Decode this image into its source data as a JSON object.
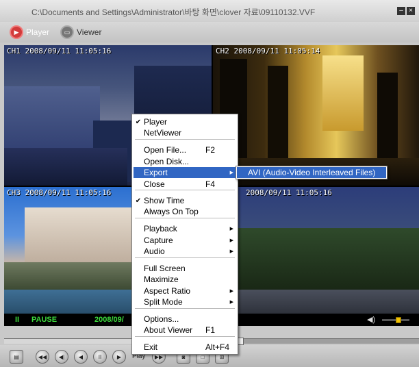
{
  "window": {
    "title": "C:\\Documents and Settings\\Administrator\\바탕 화면\\clover 자료\\09110132.VVF",
    "minimize": "–",
    "close": "×"
  },
  "modes": {
    "player_label": "Player",
    "viewer_label": "Viewer"
  },
  "cameras": [
    {
      "label": "CH1 2008/09/11 11:05:16"
    },
    {
      "label": "CH2 2008/09/11 11:05:14"
    },
    {
      "label": "CH3 2008/09/11 11:05:16"
    },
    {
      "label": "2008/09/11 11:05:16"
    }
  ],
  "status": {
    "pause_icon": "II",
    "state": "PAUSE",
    "time": "2008/09/",
    "volume_level": 0.6
  },
  "seek": {
    "position": 0.57
  },
  "controls": {
    "play_label": "Play"
  },
  "context_menu": {
    "items": [
      {
        "label": "Player",
        "checked": true
      },
      {
        "label": "NetViewer"
      },
      {
        "label": "Open File...",
        "shortcut": "F2"
      },
      {
        "label": "Open Disk..."
      },
      {
        "label": "Export",
        "submenu": true,
        "highlighted": true
      },
      {
        "label": "Close",
        "shortcut": "F4"
      },
      {
        "label": "Show Time",
        "checked": true
      },
      {
        "label": "Always On Top"
      },
      {
        "label": "Playback",
        "submenu": true
      },
      {
        "label": "Capture",
        "submenu": true
      },
      {
        "label": "Audio",
        "submenu": true
      },
      {
        "label": "Full Screen"
      },
      {
        "label": "Maximize"
      },
      {
        "label": "Aspect Ratio",
        "submenu": true
      },
      {
        "label": "Split Mode",
        "submenu": true
      },
      {
        "label": "Options..."
      },
      {
        "label": "About Viewer",
        "shortcut": "F1"
      },
      {
        "label": "Exit",
        "shortcut": "Alt+F4"
      }
    ],
    "export_submenu": {
      "label": "AVI (Audio-Video Interleaved Files)",
      "highlighted": true
    }
  },
  "colors": {
    "menu_highlight": "#3166c3",
    "status_text": "#3cdc3c",
    "player_accent": "#d23b3b"
  }
}
